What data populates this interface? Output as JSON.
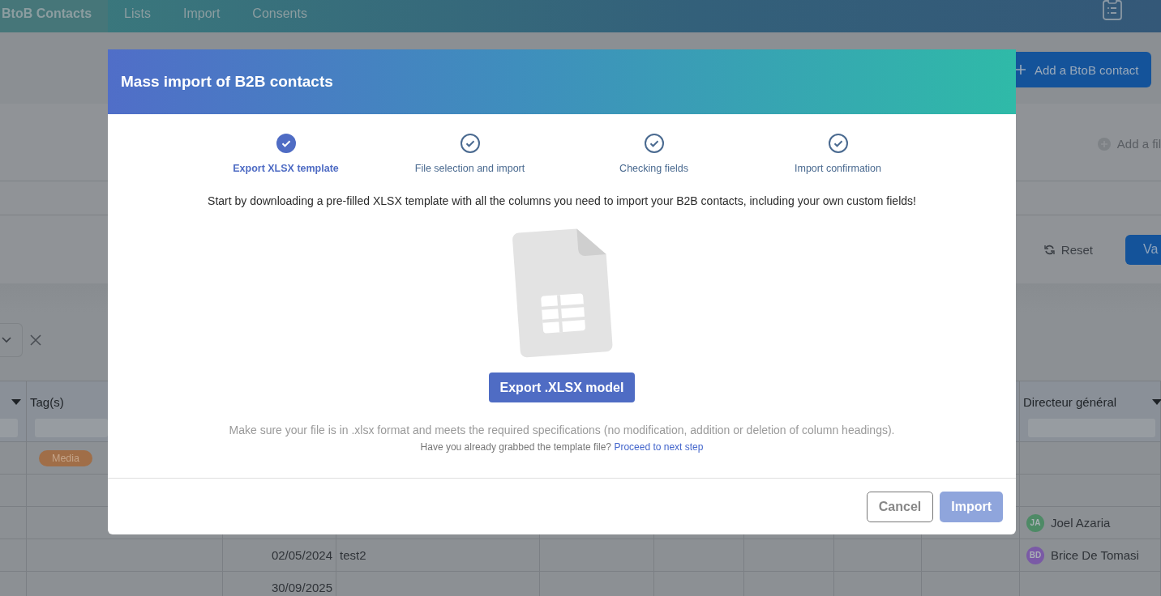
{
  "nav": {
    "tabs": [
      {
        "label": "BtoB Contacts",
        "selected": true
      },
      {
        "label": "Lists",
        "selected": false
      },
      {
        "label": "Import",
        "selected": false
      },
      {
        "label": "Consents",
        "selected": false
      }
    ]
  },
  "add_contact_button": "Add a BtoB contact",
  "filters": {
    "add_filter": "Add a fil",
    "reset": "Reset",
    "apply": "Va"
  },
  "table": {
    "columns": [
      {
        "label": "Tag(s)"
      },
      {
        "label": "Directeur général"
      }
    ],
    "rows": [
      {
        "tag": "Media"
      },
      {},
      {
        "director": {
          "initials": "JA",
          "name": "Joel Azaria",
          "color": "#4e8a66"
        }
      },
      {
        "date": "02/05/2024",
        "text": "test2",
        "director": {
          "initials": "BD",
          "name": "Brice De Tomasi",
          "color": "#7a5aa6"
        }
      },
      {
        "date": "30/09/2025"
      }
    ]
  },
  "modal": {
    "title": "Mass import of B2B contacts",
    "steps": [
      {
        "label": "Export XLSX template",
        "selected": true
      },
      {
        "label": "File selection and import",
        "selected": false
      },
      {
        "label": "Checking fields",
        "selected": false
      },
      {
        "label": "Import confirmation",
        "selected": false
      }
    ],
    "intro": "Start by downloading a pre-filled XLSX template with all the columns you need to import your B2B contacts, including your own custom fields!",
    "export_button": "Export .XLSX model",
    "note": "Make sure your file is in .xlsx format and meets the required specifications (no modification, addition or deletion of column headings).",
    "hint": {
      "text": "Have you already grabbed the template file?",
      "link": "Proceed to next step"
    },
    "buttons": [
      {
        "label": "Cancel",
        "kind": "secondary",
        "disabled": false
      },
      {
        "label": "Import",
        "kind": "primary",
        "disabled": true
      }
    ]
  }
}
